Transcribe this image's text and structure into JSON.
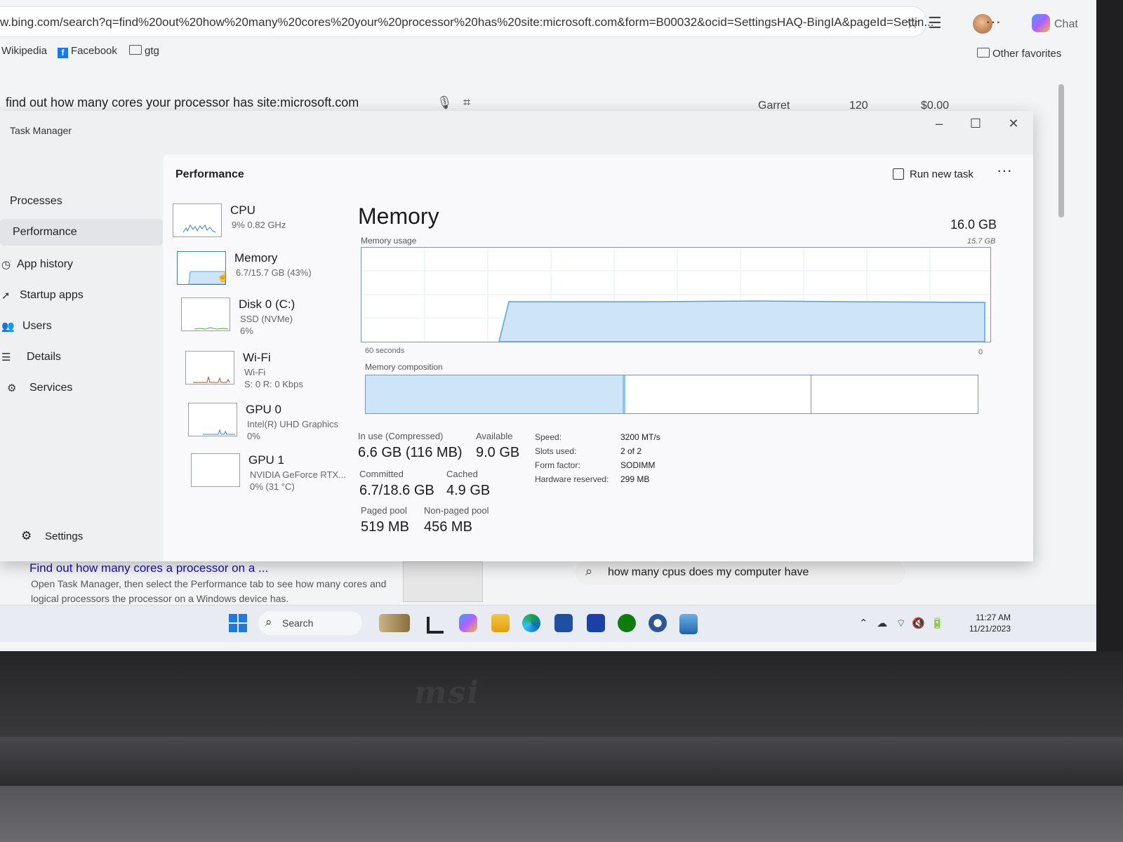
{
  "browser": {
    "url": "w.bing.com/search?q=find%20out%20how%20many%20cores%20your%20processor%20has%20site:microsoft.com&form=B00032&ocid=SettingsHAQ-BingIA&pageId=Settin...",
    "chat_label": "Chat",
    "favorites": [
      "Wikipedia",
      "Facebook",
      "gtg"
    ],
    "other_favorites": "Other favorites"
  },
  "bing": {
    "query": "find out how many cores your processor has site:microsoft.com",
    "user": "Garret",
    "points": "120",
    "cash": "$0.00",
    "result_title": "Find out how many cores a processor on a ...",
    "result_snippet": "Open Task Manager, then select the Performance tab to see how many cores and logical processors the processor on a Windows device has.",
    "related_search": "how many cpus does my computer have"
  },
  "task_manager": {
    "title": "Task Manager",
    "nav": [
      "Processes",
      "Performance",
      "App history",
      "Startup apps",
      "Users",
      "Details",
      "Services"
    ],
    "settings": "Settings",
    "heading": "Performance",
    "run_new_task": "Run new task",
    "devices": [
      {
        "name": "CPU",
        "sub1": "9% 0.82 GHz",
        "sub2": "",
        "sub3": ""
      },
      {
        "name": "Memory",
        "sub1": "6.7/15.7 GB (43%)",
        "sub2": "",
        "sub3": ""
      },
      {
        "name": "Disk 0 (C:)",
        "sub1": "SSD (NVMe)",
        "sub2": "6%",
        "sub3": ""
      },
      {
        "name": "Wi-Fi",
        "sub1": "Wi-Fi",
        "sub2": "S: 0 R: 0 Kbps",
        "sub3": ""
      },
      {
        "name": "GPU 0",
        "sub1": "Intel(R) UHD Graphics",
        "sub2": "0%",
        "sub3": ""
      },
      {
        "name": "GPU 1",
        "sub1": "NVIDIA GeForce RTX...",
        "sub2": "0% (31 °C)",
        "sub3": ""
      }
    ],
    "memory": {
      "title": "Memory",
      "total": "16.0 GB",
      "usage_label": "Memory usage",
      "usage_max": "15.7 GB",
      "graph_left": "60 seconds",
      "graph_right": "0",
      "composition_label": "Memory composition",
      "in_use_fraction": 0.42,
      "modified_fraction": 0.005,
      "standby_end_fraction": 0.727,
      "stats": {
        "in_use_label": "In use (Compressed)",
        "in_use": "6.6 GB (116 MB)",
        "available_label": "Available",
        "available": "9.0 GB",
        "committed_label": "Committed",
        "committed": "6.7/18.6 GB",
        "cached_label": "Cached",
        "cached": "4.9 GB",
        "paged_label": "Paged pool",
        "paged": "519 MB",
        "nonpaged_label": "Non-paged pool",
        "nonpaged": "456 MB"
      },
      "details": [
        {
          "k": "Speed:",
          "v": "3200 MT/s"
        },
        {
          "k": "Slots used:",
          "v": "2 of 2"
        },
        {
          "k": "Form factor:",
          "v": "SODIMM"
        },
        {
          "k": "Hardware reserved:",
          "v": "299 MB"
        }
      ]
    }
  },
  "taskbar": {
    "search": "Search",
    "time": "11:27 AM",
    "date": "11/21/2023"
  },
  "brand": "msi",
  "colors": {
    "accent": "#0f6cbd",
    "graph_fill": "#cde5f6",
    "graph_line": "#5a9fd4"
  }
}
